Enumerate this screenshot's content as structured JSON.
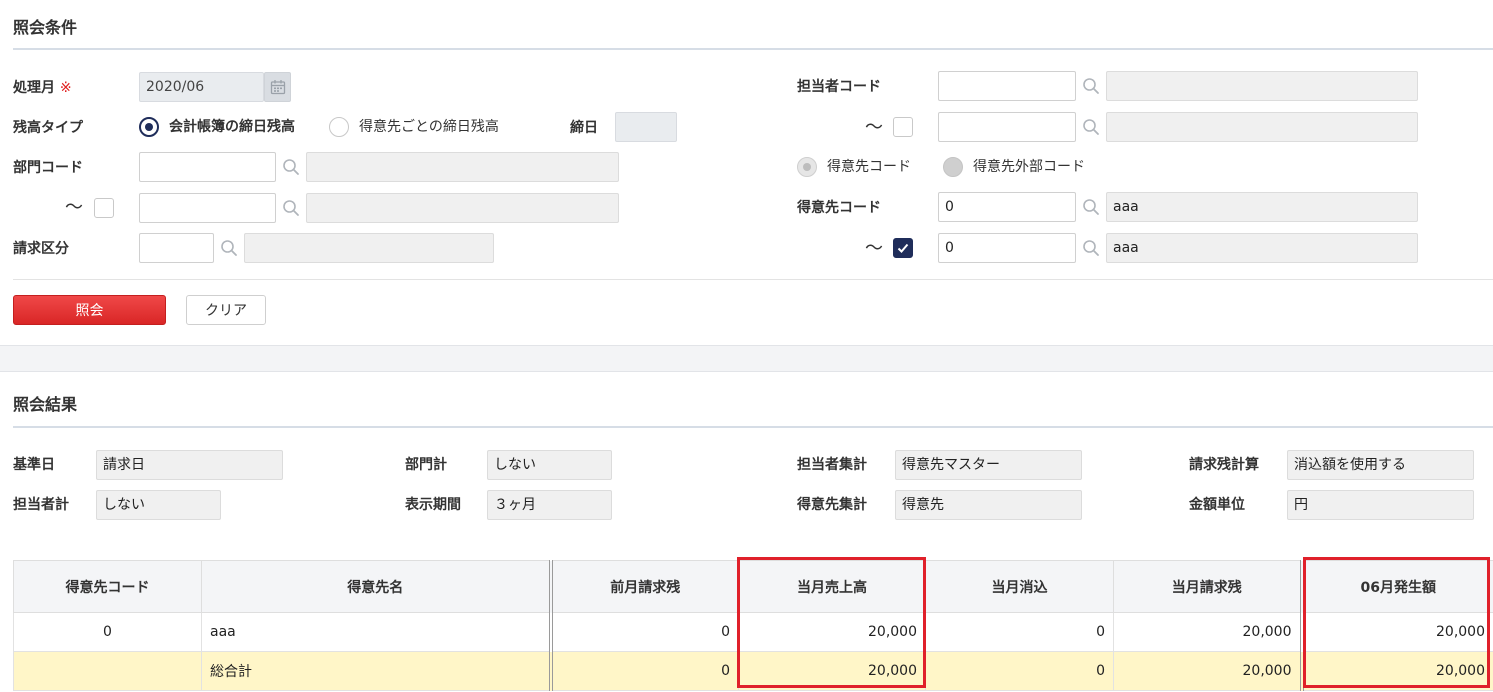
{
  "conditions": {
    "title": "照会条件",
    "month": {
      "label": "処理月",
      "required_mark": "※",
      "value": "2020/06"
    },
    "balance_type": {
      "label": "残高タイプ",
      "option1": "会計帳簿の締日残高",
      "option2": "得意先ごとの締日残高",
      "closing_label": "締日",
      "closing_value": ""
    },
    "dept": {
      "label": "部門コード",
      "from_value": "",
      "from_name": "",
      "tilde": "～",
      "to_value": "",
      "to_name": ""
    },
    "billing": {
      "label": "請求区分",
      "value": "",
      "name": ""
    },
    "staff": {
      "label": "担当者コード",
      "from_value": "",
      "from_name": "",
      "tilde": "～",
      "to_value": "",
      "to_name": ""
    },
    "customer_mode": {
      "option1": "得意先コード",
      "option2": "得意先外部コード"
    },
    "customer": {
      "label": "得意先コード",
      "from_value": "0",
      "from_name": "aaa",
      "tilde": "～",
      "to_value": "0",
      "to_name": "aaa"
    },
    "search_button": "照会",
    "clear_button": "クリア"
  },
  "results": {
    "title": "照会結果",
    "settings": [
      {
        "label": "基準日",
        "value": "請求日"
      },
      {
        "label": "部門計",
        "value": "しない"
      },
      {
        "label": "担当者集計",
        "value": "得意先マスター"
      },
      {
        "label": "請求残計算",
        "value": "消込額を使用する"
      },
      {
        "label": "担当者計",
        "value": "しない"
      },
      {
        "label": "表示期間",
        "value": "３ヶ月"
      },
      {
        "label": "得意先集計",
        "value": "得意先"
      },
      {
        "label": "金額単位",
        "value": "円"
      }
    ],
    "columns": [
      "得意先コード",
      "得意先名",
      "前月請求残",
      "当月売上高",
      "当月消込",
      "当月請求残",
      "06月発生額"
    ],
    "rows": [
      {
        "code": "0",
        "name": "aaa",
        "prev": "0",
        "sales": "20,000",
        "cleared": "0",
        "balance": "20,000",
        "occur": "20,000"
      }
    ],
    "total": {
      "code": "",
      "name": "総合計",
      "prev": "0",
      "sales": "20,000",
      "cleared": "0",
      "balance": "20,000",
      "occur": "20,000"
    }
  },
  "colors": {
    "accent": "#1f2d5a",
    "primary_button": "#e53333",
    "highlight_box": "#e0202a",
    "link": "#2f7fd6",
    "total_row": "#fff6c8"
  }
}
